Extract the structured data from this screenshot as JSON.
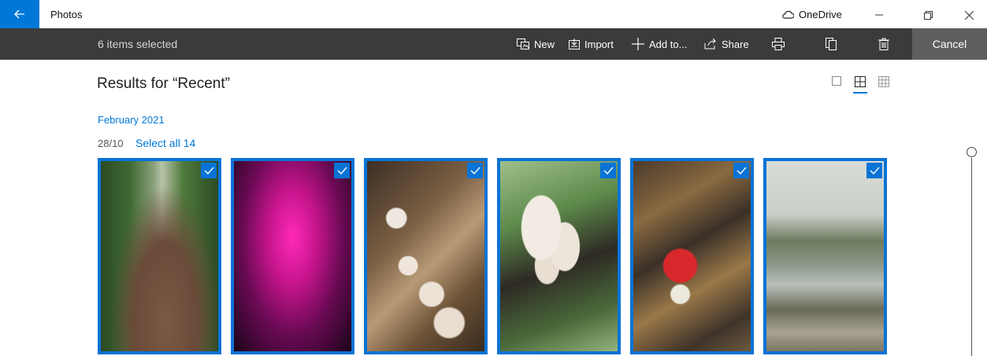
{
  "window": {
    "app_title": "Photos",
    "cloud_label": "OneDrive"
  },
  "selection_bar": {
    "count_text": "6 items selected",
    "actions": {
      "new_label": "New",
      "import_label": "Import",
      "add_label": "Add to...",
      "share_label": "Share"
    },
    "cancel_label": "Cancel"
  },
  "content": {
    "results_title": "Results for “Recent”",
    "month_label": "February 2021",
    "date_label": "28/10",
    "select_all_label": "Select all 14",
    "view_mode": "medium"
  },
  "photos": [
    {
      "subject": "woodland path",
      "selected": true
    },
    {
      "subject": "pink illuminated tree",
      "selected": true
    },
    {
      "subject": "mushrooms on log",
      "selected": true
    },
    {
      "subject": "white bracket fungi",
      "selected": true
    },
    {
      "subject": "red fly agaric mushroom",
      "selected": true
    },
    {
      "subject": "river landscape",
      "selected": true
    }
  ],
  "zoom_slider": {
    "value": 0
  }
}
